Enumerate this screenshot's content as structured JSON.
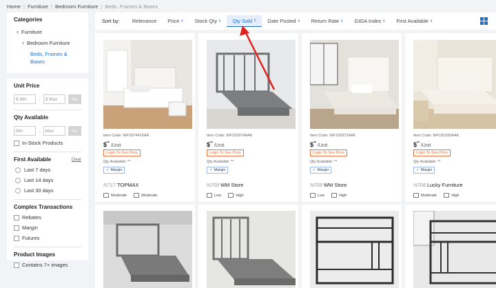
{
  "breadcrumb": [
    "Home",
    "Furniture",
    "Bedroom Furniture",
    "Beds, Frames & Bases"
  ],
  "sidebar": {
    "categories_title": "Categories",
    "categories": [
      "Furniture",
      "Bedroom Furniture",
      "Beds, Frames & Bases"
    ],
    "unit_price_title": "Unit Price",
    "min_price_placeholder": "$ Min",
    "max_price_placeholder": "$ Max",
    "go_label": "Go",
    "qty_available_title": "Qty Available",
    "min_placeholder": "Min",
    "max_placeholder": "Max",
    "in_stock_label": "In-Stock Products",
    "first_available_title": "First Available",
    "clear_label": "Clear",
    "first_available_options": [
      "Last 7 days",
      "Last 14 days",
      "Last 30 days"
    ],
    "complex_title": "Complex Transactions",
    "complex_options": [
      "Rebates",
      "Margin",
      "Futures"
    ],
    "images_title": "Product Images",
    "images_option": "Contains 7+ images"
  },
  "sortbar": {
    "label": "Sort by:",
    "options": [
      "Relevance",
      "Price",
      "Stock Qty",
      "Qty Sold",
      "Date Posted",
      "Return Rate",
      "GIGA Index",
      "First Available"
    ],
    "active": "Qty Sold",
    "arrow_glyph": "⇕"
  },
  "products": [
    {
      "code": "Item Code:  WF187441KAA",
      "price_dollar": "$",
      "price_stars": "**",
      "unit": " /Unit",
      "login": "Login To See Price",
      "qty": "Qty Available: **",
      "margin": "Margin",
      "store_num": "N717",
      "store_name": "TOPMAX",
      "tag1": "Moderate",
      "tag2": "Moderate"
    },
    {
      "code": "Item Code:  WF192974AAK",
      "price_dollar": "$",
      "price_stars": "**",
      "unit": " /Unit",
      "login": "Login To See Price",
      "qty": "Qty Available: **",
      "margin": "Margin",
      "store_num": "N709",
      "store_name": "WM Store",
      "tag1": "Low",
      "tag2": "High"
    },
    {
      "code": "Item Code:  WF192972AAK",
      "price_dollar": "$",
      "price_stars": "**",
      "unit": " /Unit",
      "login": "Login To See Price",
      "qty": "Qty Available: **",
      "margin": "Margin",
      "store_num": "N709",
      "store_name": "WM Store",
      "tag1": "Low",
      "tag2": "High"
    },
    {
      "code": "Item Code:  WF191555AAK",
      "price_dollar": "$",
      "price_stars": "**",
      "unit": " /Unit",
      "login": "Login To See Price",
      "qty": "Qty Available: **",
      "margin": "Margin",
      "store_num": "N708",
      "store_name": "Lucky Furniture",
      "tag1": "Moderate",
      "tag2": "High"
    }
  ],
  "colors": {
    "accent": "#1a6fd1",
    "login": "#e8703a",
    "arrow": "#e0201c"
  }
}
